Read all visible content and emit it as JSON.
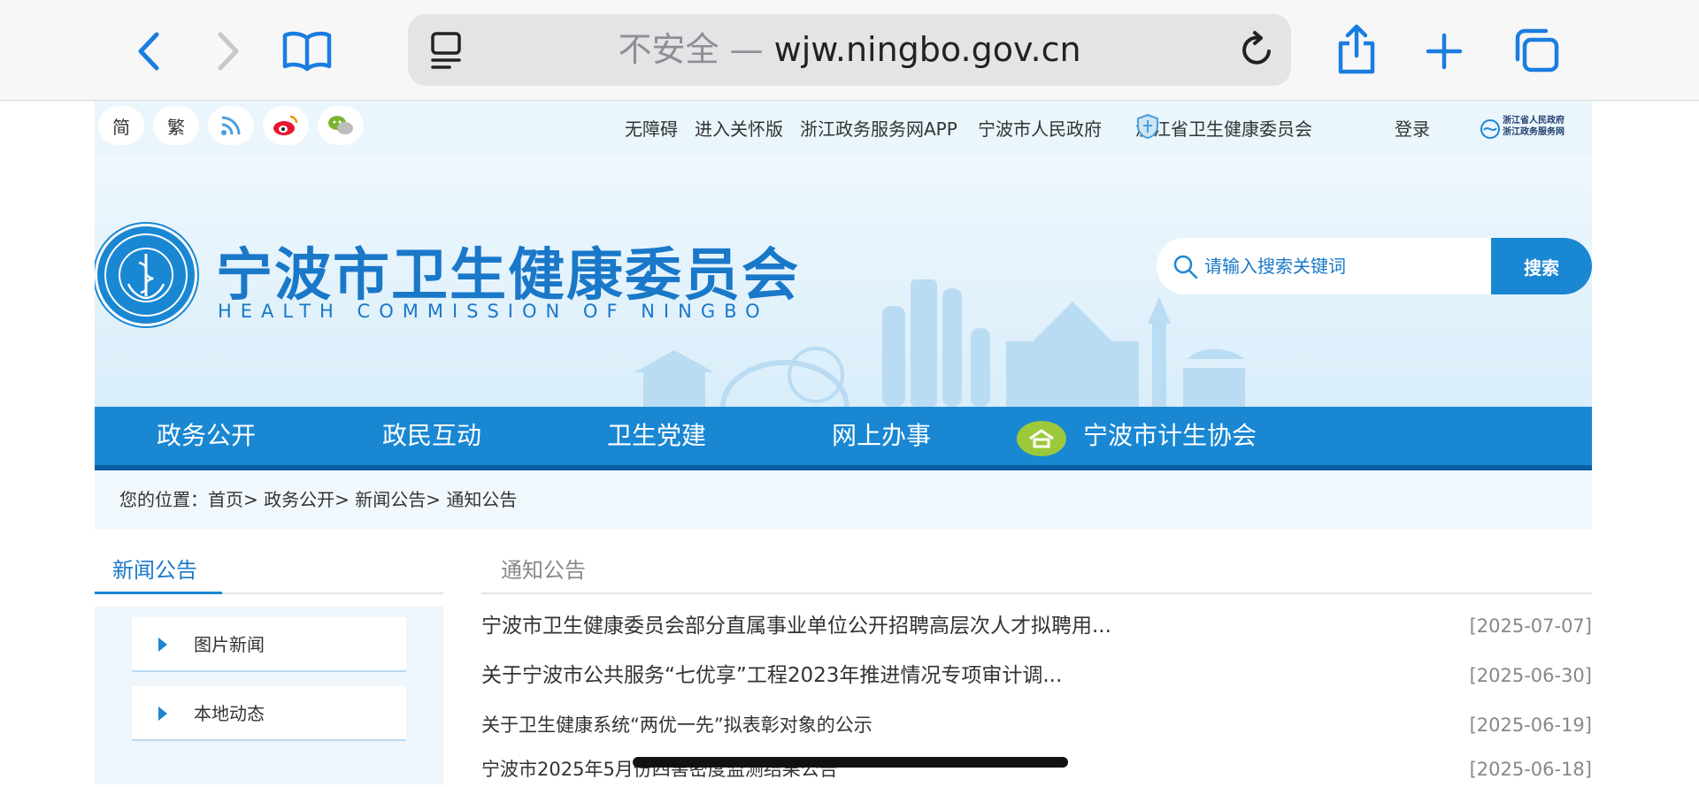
{
  "browser": {
    "address_insecure": "不安全 —",
    "address_domain": "wjw.ningbo.gov.cn"
  },
  "topbar": {
    "simplified": "简",
    "traditional": "繁",
    "links": [
      "无障碍",
      "进入关怀版",
      "浙江政务服务网APP",
      "宁波市人民政府",
      "浙江省卫生健康委员会",
      "登录"
    ],
    "zj_gov_logo_line1": "浙江省人民政府",
    "zj_gov_logo_line2": "浙江政务服务网"
  },
  "header": {
    "title": "宁波市卫生健康委员会",
    "subtitle": "HEALTH COMMISSION  OF NINGBO",
    "search_placeholder": "请输入搜索关键词",
    "search_button": "搜索"
  },
  "nav": {
    "items": [
      "政务公开",
      "政民互动",
      "卫生党建",
      "网上办事",
      "宁波市计生协会"
    ]
  },
  "breadcrumb": "您的位置：首页> 政务公开> 新闻公告> 通知公告",
  "sidebar": {
    "tab": "新闻公告",
    "items": [
      "图片新闻",
      "本地动态"
    ]
  },
  "main": {
    "tab": "通知公告",
    "rows": [
      {
        "title": "宁波市卫生健康委员会部分直属事业单位公开招聘高层次人才拟聘用...",
        "date": "[2025-07-07]"
      },
      {
        "title": "关于宁波市公共服务“七优享”工程2023年推进情况专项审计调...",
        "date": "[2025-06-30]"
      },
      {
        "title": "关于卫生健康系统“两优一先”拟表彰对象的公示",
        "date": "[2025-06-19]"
      },
      {
        "title": "宁波市2025年5月份四害密度监测结果公告",
        "date": "[2025-06-18]"
      }
    ]
  },
  "colors": {
    "brand_blue": "#1a87d3",
    "nav_border": "#0b5fa5",
    "badge_green": "#9cc93b"
  }
}
